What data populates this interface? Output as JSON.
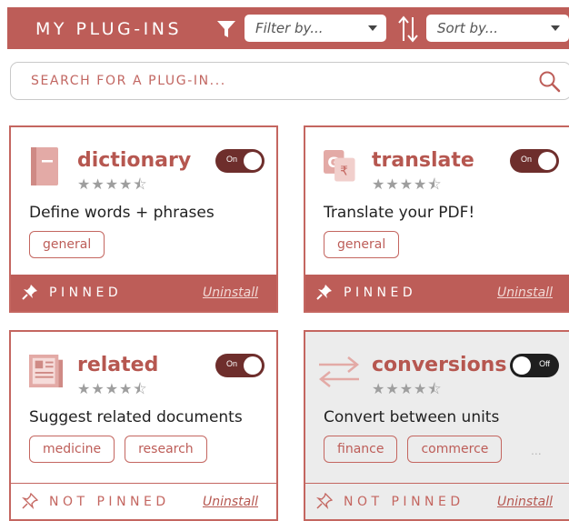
{
  "header": {
    "title": "MY PLUG-INS",
    "filter_placeholder": "Filter by...",
    "sort_placeholder": "Sort by...",
    "filter_icon": "funnel-icon",
    "sort_icon": "sort-arrows-icon"
  },
  "search": {
    "placeholder": "SEARCH FOR A PLUG-IN...",
    "icon": "search-icon"
  },
  "colors": {
    "accent": "#bd5d58",
    "toggle_on": "#6e2e2c",
    "toggle_off": "#1e1e1e",
    "disabled_bg": "#ececec"
  },
  "plugins": [
    {
      "name": "dictionary",
      "icon": "book-icon",
      "rating": 4.5,
      "stars": "★★★★⯪",
      "enabled": true,
      "toggle_label": "On",
      "description": "Define words + phrases",
      "tags": [
        "general"
      ],
      "pin_label": "PINNED",
      "pinned": true,
      "uninstall_label": "Uninstall"
    },
    {
      "name": "translate",
      "icon": "translate-icon",
      "rating": 4.5,
      "stars": "★★★★⯪",
      "enabled": true,
      "toggle_label": "On",
      "description": "Translate your PDF!",
      "tags": [
        "general"
      ],
      "pin_label": "PINNED",
      "pinned": true,
      "uninstall_label": "Uninstall"
    },
    {
      "name": "related",
      "icon": "newspaper-icon",
      "rating": 4.5,
      "stars": "★★★★⯪",
      "enabled": true,
      "toggle_label": "On",
      "description": "Suggest related documents",
      "tags": [
        "medicine",
        "research"
      ],
      "pin_label": "NOT PINNED",
      "pinned": false,
      "uninstall_label": "Uninstall"
    },
    {
      "name": "conversions",
      "icon": "swap-arrows-icon",
      "rating": 4.5,
      "stars": "★★★★⯪",
      "enabled": false,
      "toggle_label": "Off",
      "description": "Convert between units",
      "tags": [
        "finance",
        "commerce"
      ],
      "more": "...",
      "pin_label": "NOT PINNED",
      "pinned": false,
      "uninstall_label": "Uninstall"
    }
  ]
}
